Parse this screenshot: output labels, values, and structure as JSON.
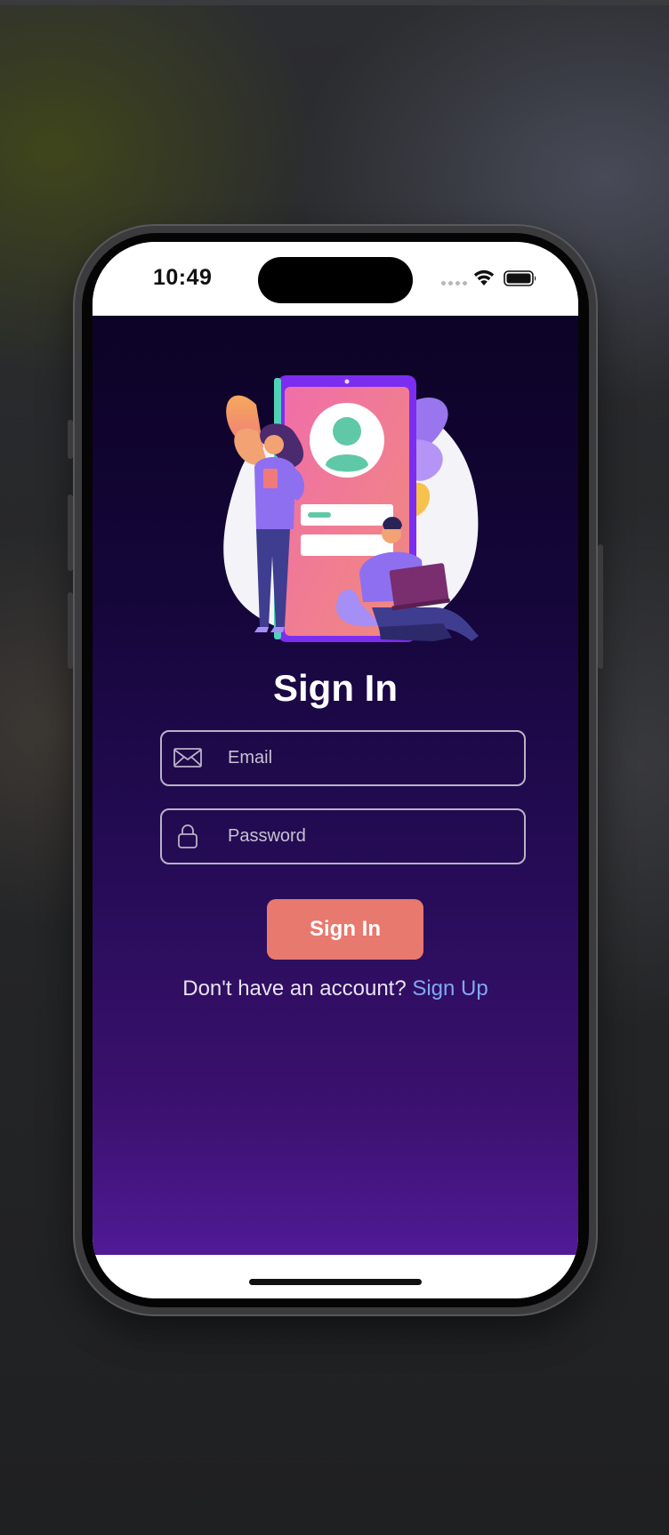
{
  "status_bar": {
    "time": "10:49",
    "icons": [
      "cellular-signal-icon",
      "wifi-icon",
      "battery-icon"
    ]
  },
  "illustration": {
    "icon": "sign-in-illustration"
  },
  "login": {
    "title": "Sign In",
    "email": {
      "icon": "envelope-icon",
      "placeholder": "Email",
      "value": ""
    },
    "password": {
      "icon": "lock-icon",
      "placeholder": "Password",
      "value": ""
    },
    "submit_label": "Sign In",
    "signup_prompt": "Don't have an account?",
    "signup_link": "Sign Up"
  },
  "colors": {
    "background_top": "#0c0326",
    "background_bottom": "#501a95",
    "button": "#e8796e",
    "link": "#7fa8f5",
    "field_border": "#b9b2c8"
  }
}
